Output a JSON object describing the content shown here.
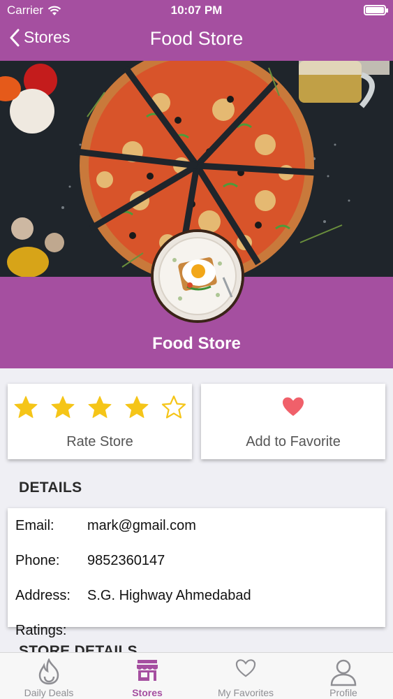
{
  "status_bar": {
    "carrier": "Carrier",
    "time": "10:07 PM",
    "battery_level": 1.0
  },
  "nav": {
    "back_label": "Stores",
    "title": "Food Store"
  },
  "store": {
    "name": "Food Store"
  },
  "rating": {
    "value": 4,
    "max": 5,
    "label": "Rate Store"
  },
  "favorite": {
    "label": "Add to Favorite"
  },
  "details": {
    "title": "DETAILS",
    "email_label": "Email:",
    "email": "mark@gmail.com",
    "phone_label": "Phone:",
    "phone": "9852360147",
    "address_label": "Address:",
    "address": "S.G. Highway Ahmedabad",
    "ratings_label": "Ratings:"
  },
  "store_details_title": "STORE DETAILS",
  "tabs": [
    {
      "label": "Daily Deals",
      "icon": "flame-icon",
      "active": false
    },
    {
      "label": "Stores",
      "icon": "store-icon",
      "active": true
    },
    {
      "label": "My Favorites",
      "icon": "heart-outline-icon",
      "active": false
    },
    {
      "label": "Profile",
      "icon": "person-icon",
      "active": false
    }
  ],
  "colors": {
    "primary": "#a54fa0",
    "star": "#f5c518",
    "heart": "#f0606a"
  }
}
